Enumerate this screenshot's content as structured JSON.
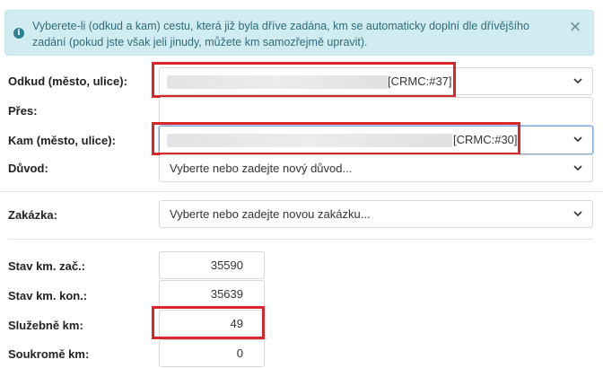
{
  "alert": {
    "text": "Vyberete-li (odkud a kam) cestu, která již byla dříve zadána, km se automaticky doplní dle dřívějšího zadání (pokud jste však jeli jinudy, můžete km samozřejmě upravit).",
    "icon": "info-icon",
    "close_icon": "×",
    "bg_color": "#d1ecf1"
  },
  "form": {
    "odkud": {
      "label": "Odkud (město, ulice):",
      "tag": "[CRMC:#37]"
    },
    "pres": {
      "label": "Přes:",
      "value": ""
    },
    "kam": {
      "label": "Kam (město, ulice):",
      "tag": "[CRMC:#30]"
    },
    "duvod": {
      "label": "Důvod:",
      "placeholder": "Vyberte nebo zadejte nový důvod..."
    },
    "zakazka": {
      "label": "Zakázka:",
      "placeholder": "Vyberte nebo zadejte novou zakázku..."
    },
    "stav_zac": {
      "label": "Stav km. zač.:",
      "value": "35590"
    },
    "stav_kon": {
      "label": "Stav km. kon.:",
      "value": "35639"
    },
    "sluzebne": {
      "label": "Služebně km:",
      "value": "49"
    },
    "soukrome": {
      "label": "Soukromě km:",
      "value": "0"
    }
  },
  "highlight_color": "#d9262b"
}
